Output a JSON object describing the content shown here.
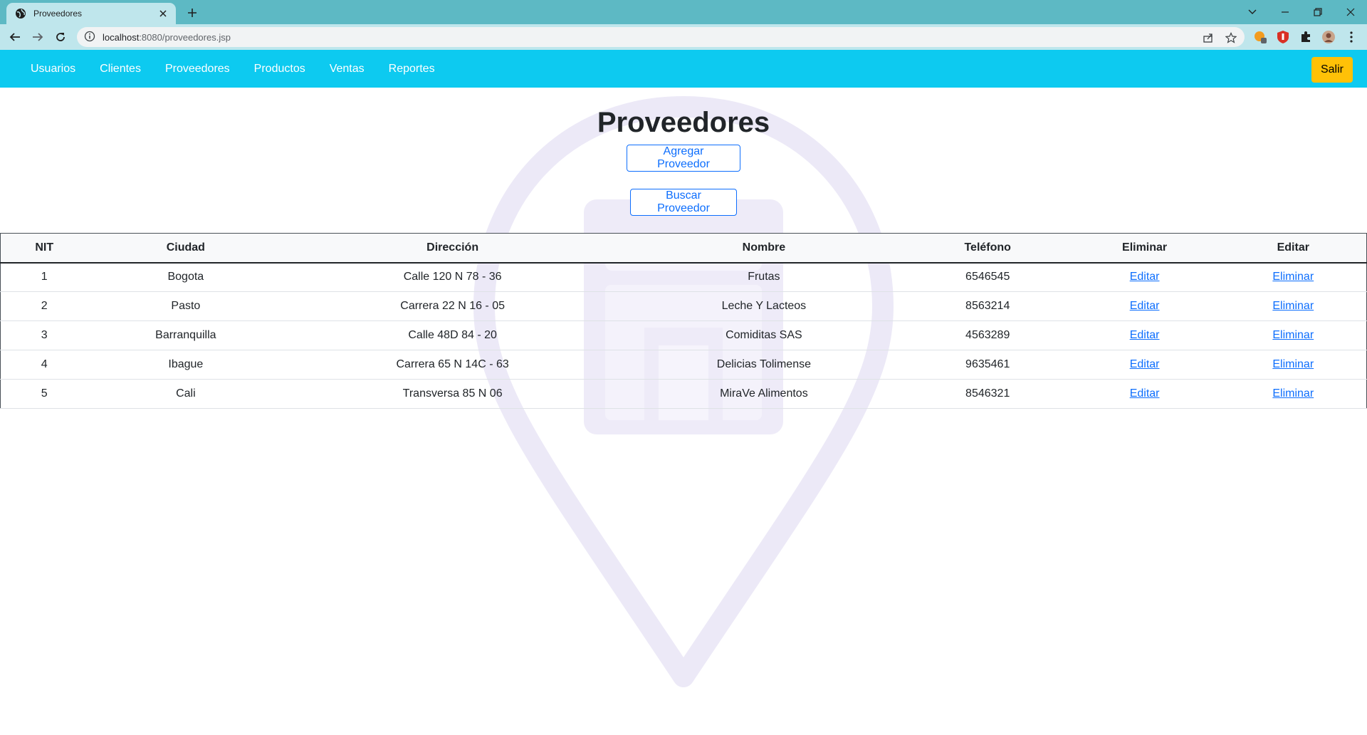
{
  "browser": {
    "tab_title": "Proveedores",
    "url_host": "localhost",
    "url_path": ":8080/proveedores.jsp"
  },
  "nav": {
    "items": [
      "Usuarios",
      "Clientes",
      "Proveedores",
      "Productos",
      "Ventas",
      "Reportes"
    ],
    "logout_label": "Salir"
  },
  "page": {
    "title": "Proveedores",
    "add_button": "Agregar Proveedor",
    "search_button": "Buscar Proveedor"
  },
  "table": {
    "headers": [
      "NIT",
      "Ciudad",
      "Dirección",
      "Nombre",
      "Teléfono",
      "Eliminar",
      "Editar"
    ],
    "rows": [
      {
        "nit": "1",
        "ciudad": "Bogota",
        "direccion": "Calle 120 N 78 - 36",
        "nombre": "Frutas",
        "telefono": "6546545",
        "col_eliminar": "Editar",
        "col_editar": "Eliminar"
      },
      {
        "nit": "2",
        "ciudad": "Pasto",
        "direccion": "Carrera 22 N 16 - 05",
        "nombre": "Leche Y Lacteos",
        "telefono": "8563214",
        "col_eliminar": "Editar",
        "col_editar": "Eliminar"
      },
      {
        "nit": "3",
        "ciudad": "Barranquilla",
        "direccion": "Calle 48D 84 - 20",
        "nombre": "Comiditas SAS",
        "telefono": "4563289",
        "col_eliminar": "Editar",
        "col_editar": "Eliminar"
      },
      {
        "nit": "4",
        "ciudad": "Ibague",
        "direccion": "Carrera 65 N 14C - 63",
        "nombre": "Delicias Tolimense",
        "telefono": "9635461",
        "col_eliminar": "Editar",
        "col_editar": "Eliminar"
      },
      {
        "nit": "5",
        "ciudad": "Cali",
        "direccion": "Transversa 85 N 06",
        "nombre": "MiraVe Alimentos",
        "telefono": "8546321",
        "col_eliminar": "Editar",
        "col_editar": "Eliminar"
      }
    ]
  },
  "colors": {
    "navbar": "#0dcaf0",
    "logout": "#ffc107",
    "primary": "#0d6efd",
    "tabstrip": "#5db9c4",
    "watermark": "#e9e6f6"
  },
  "icons": {
    "watermark": "store-location-pin-icon"
  }
}
